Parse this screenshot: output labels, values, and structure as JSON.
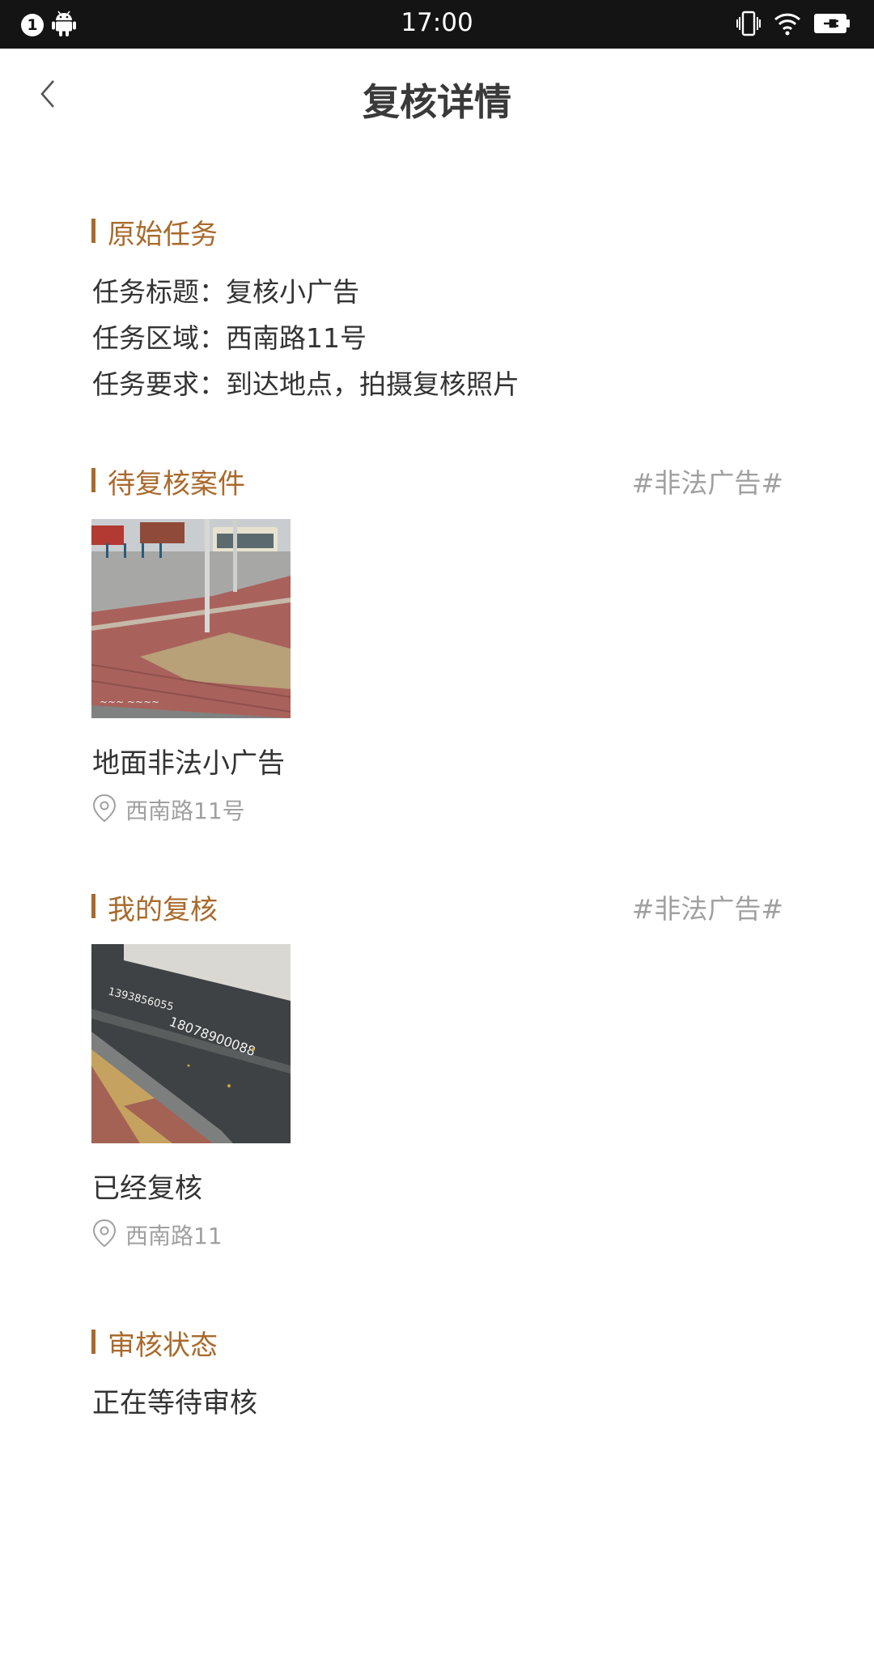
{
  "status_bar": {
    "notification_count": "1",
    "time": "17:00",
    "icons": [
      "notification-badge",
      "android-icon",
      "vibrate-icon",
      "wifi-icon",
      "battery-charging-icon"
    ]
  },
  "header": {
    "title": "复核详情",
    "back_icon": "chevron-left-icon"
  },
  "original_task": {
    "section_title": "原始任务",
    "lines": [
      {
        "label": "任务标题：",
        "value": "复核小广告"
      },
      {
        "label": "任务区域：",
        "value": "西南路11号"
      },
      {
        "label": "任务要求：",
        "value": "到达地点，拍摄复核照片"
      }
    ]
  },
  "pending_case": {
    "section_title": "待复核案件",
    "tag": "#非法广告#",
    "photo_description": "sidewalk-photo",
    "item_title": "地面非法小广告",
    "location": "西南路11号"
  },
  "my_review": {
    "section_title": "我的复核",
    "tag": "#非法广告#",
    "photo_description": "graffiti-curb-photo",
    "item_title": "已经复核",
    "location": "西南路11"
  },
  "audit_status": {
    "section_title": "审核状态",
    "status": "正在等待审核"
  },
  "colors": {
    "accent": "#a96a2c",
    "muted": "#a0a0a0",
    "body_text": "#333333",
    "status_bar_bg": "#141414"
  }
}
